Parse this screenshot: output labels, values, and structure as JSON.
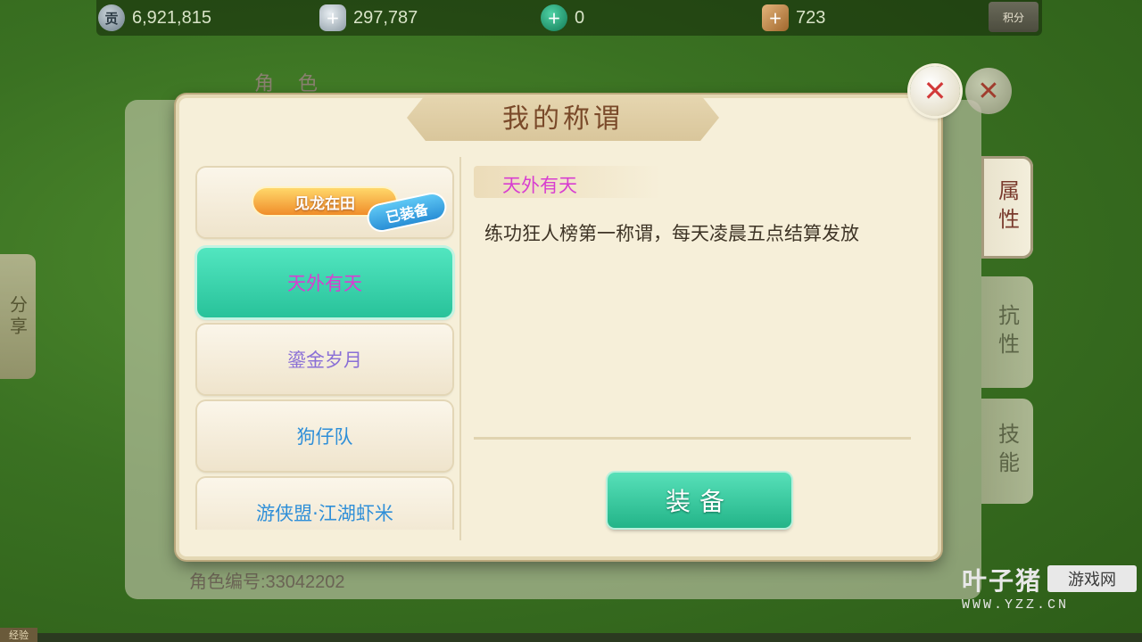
{
  "currencies": [
    {
      "icon": "tribute-coin-icon",
      "glyph": "贡",
      "value": "6,921,815"
    },
    {
      "icon": "silver-ingot-icon",
      "glyph": "",
      "value": "297,787"
    },
    {
      "icon": "jade-coin-icon",
      "glyph": "",
      "value": "0"
    },
    {
      "icon": "ticket-icon",
      "glyph": "",
      "value": "723"
    }
  ],
  "points_label": "积分",
  "background": {
    "panel_title": "角 色",
    "tabs": {
      "attributes": "属性",
      "resistance": "抗性",
      "skills": "技能"
    },
    "share_label": "分享",
    "role_id": "角色编号:33042202",
    "exp_label": "经验"
  },
  "dialog": {
    "title": "我的称谓",
    "close_glyph": "✕",
    "titles_list": [
      {
        "name": "见龙在田",
        "equipped_tag": "已装备",
        "color": "#ffffff"
      },
      {
        "name": "天外有天",
        "color": "#d83ed0"
      },
      {
        "name": "鎏金岁月",
        "color": "#8a6fd6"
      },
      {
        "name": "狗仔队",
        "color": "#2f8fd8"
      },
      {
        "name": "游侠盟·江湖虾米",
        "color": "#2f8fd8"
      }
    ],
    "detail": {
      "name": "天外有天",
      "description": "练功狂人榜第一称谓，每天凌晨五点结算发放"
    },
    "equip_button": "装备"
  },
  "watermark": {
    "main": "叶子猪",
    "box": "游戏网",
    "url": "WWW.YZZ.CN"
  },
  "colors": {
    "accent_teal": "#28c29a",
    "title_brown": "#7a4a2a",
    "selected_title_magenta": "#d83ed0"
  }
}
